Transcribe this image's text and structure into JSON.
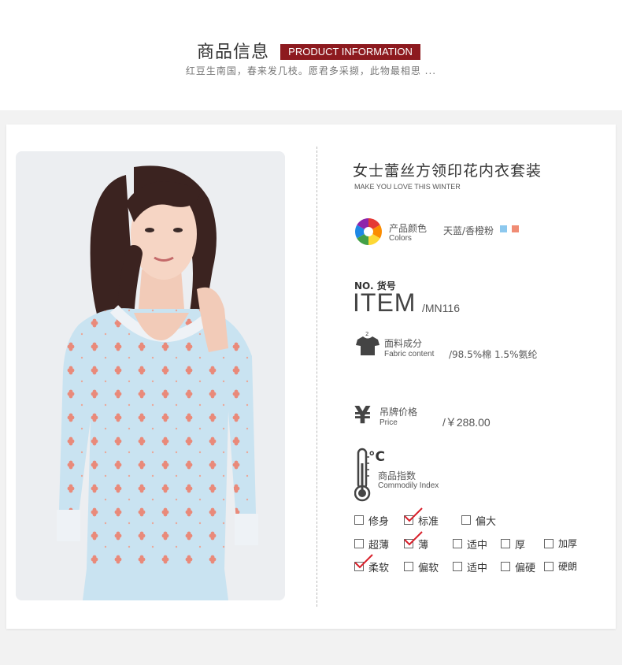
{
  "header": {
    "title_cn": "商品信息",
    "title_en": "PRODUCT INFORMATION",
    "subtitle": "红豆生南国，春来发几枝。愿君多采撷，此物最相思 ..."
  },
  "product": {
    "name": "女士蕾丝方领印花内衣套装",
    "tagline": "MAKE YOU LOVE THIS WINTER"
  },
  "colors": {
    "label_cn": "产品颜色",
    "label_en": "Colors",
    "value": "天蓝/香橙粉",
    "swatches": [
      "#8cc8ee",
      "#f08c74"
    ]
  },
  "item": {
    "no_label": "NO. 货号",
    "big_label": "ITEM",
    "value": "/MN116"
  },
  "fabric": {
    "label_cn": "面料成分",
    "label_en": "Fabric content",
    "value": "/98.5%棉 1.5%氨纶"
  },
  "price": {
    "label_cn": "吊牌价格",
    "label_en": "Price",
    "value": "/￥288.00"
  },
  "commodity_index": {
    "label_cn": "商品指数",
    "label_en": "Commodily Index",
    "unit": "°C",
    "rows": [
      [
        {
          "label": "修身",
          "checked": false
        },
        {
          "label": "标准",
          "checked": true
        },
        {
          "label": "偏大",
          "checked": false
        }
      ],
      [
        {
          "label": "超薄",
          "checked": false
        },
        {
          "label": "薄",
          "checked": true
        },
        {
          "label": "适中",
          "checked": false
        },
        {
          "label": "厚",
          "checked": false
        },
        {
          "label": "加厚",
          "checked": false
        }
      ],
      [
        {
          "label": "柔软",
          "checked": true
        },
        {
          "label": "偏软",
          "checked": false
        },
        {
          "label": "适中",
          "checked": false
        },
        {
          "label": "偏硬",
          "checked": false
        },
        {
          "label": "硬朗",
          "checked": false
        }
      ]
    ]
  },
  "accent_color": "#8d1a1f",
  "check_color": "#d81f2a"
}
